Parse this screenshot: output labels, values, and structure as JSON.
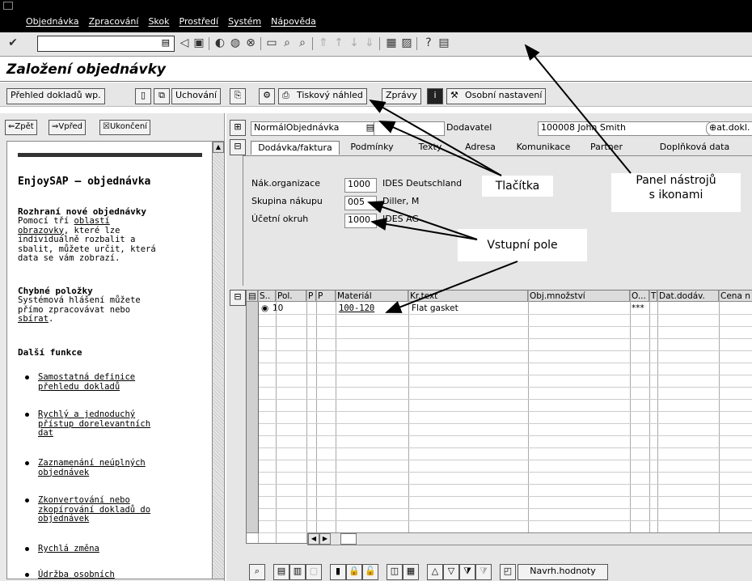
{
  "menu": [
    "Objednávka",
    "Zpracování",
    "Skok",
    "Prostředí",
    "Systém",
    "Nápověda"
  ],
  "title": "Založení objednávky",
  "app_toolbar": {
    "overview": "Přehled dokladů wp.",
    "hold": "Uchování",
    "print_preview": "Tiskový náhled",
    "messages": "Zprávy",
    "personal": "Osobní nastavení"
  },
  "help_nav": {
    "back": "Zpět",
    "forward": "Vpřed",
    "end": "Ukončení"
  },
  "help": {
    "title": "EnjoySAP – objednávka",
    "s1_title": "Rozhraní nové objednávky",
    "s1_l1": "Pomocí tří ",
    "s1_link": "oblastí",
    "s1_l2_link": "obrazovky",
    "s1_l2": ", které lze",
    "s1_l3": "individuálně rozbalit a",
    "s1_l4": "sbalit, můžete určit, která",
    "s1_l5": "data se vám zobrazí.",
    "s2_title": "Chybné položky",
    "s2_l1": "Systémová hlášení můžete",
    "s2_l2": "přímo zpracovávat nebo",
    "s2_link": "sbírat",
    "s2_end": ".",
    "s3_title": "Další funkce",
    "items": [
      [
        "Samostatná definice",
        "přehledu dokladů"
      ],
      [
        "Rychlý a jednoduchý",
        "přístup dorelevantních",
        "dat"
      ],
      [
        "Zaznamenání neúplných",
        "objednávek"
      ],
      [
        "Zkonvertování nebo",
        "zkopírování dokladů do",
        "objednávek"
      ],
      [
        "Rychlá změna"
      ],
      [
        "Údržba osobních"
      ]
    ]
  },
  "header": {
    "doc_type": "NormálObjednávka",
    "vendor_label": "Dodavatel",
    "vendor_value": "100008 John Smith",
    "doc_date_label": "at.dokl."
  },
  "tabs": [
    "Dodávka/faktura",
    "Podmínky",
    "Texty",
    "Adresa",
    "Komunikace",
    "Partner",
    "Doplňková data"
  ],
  "org": {
    "purch_org_label": "Nák.organizace",
    "purch_org_value": "1000",
    "purch_org_text": "IDES Deutschland",
    "purch_group_label": "Skupina nákupu",
    "purch_group_value": "005",
    "purch_group_text": "Diller, M",
    "company_label": "Účetní okruh",
    "company_value": "1000",
    "company_text": "IDES AG"
  },
  "grid": {
    "columns": [
      "S..",
      "Pol.",
      "P",
      "P",
      "Materiál",
      "Kr.text",
      "Obj.množství",
      "O...",
      "T",
      "Dat.dodáv.",
      "Cena n"
    ],
    "row1": {
      "item": "10",
      "material": "100-120",
      "text": "Flat gasket",
      "unit": "***"
    }
  },
  "bottom": {
    "proposal": "Navrh.hodnoty"
  },
  "annotations": {
    "buttons": "Tlačítka",
    "toolbar": "Panel nástrojů",
    "toolbar2": "s ikonami",
    "input": "Vstupní pole"
  }
}
